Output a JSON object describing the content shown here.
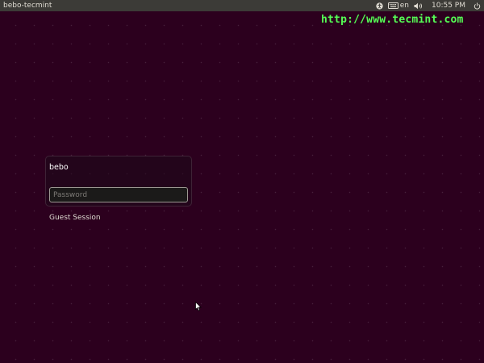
{
  "topbar": {
    "hostname": "bebo-tecmint",
    "keyboard_layout": "en",
    "clock": "10:55 PM",
    "icons": [
      "accessibility-icon",
      "keyboard-icon",
      "volume-icon",
      "power-icon"
    ]
  },
  "watermark": {
    "text": "http://www.tecmint.com",
    "color": "#55ff55"
  },
  "login": {
    "username": "bebo",
    "password_placeholder": "Password",
    "password_value": ""
  },
  "guest_session": {
    "label": "Guest Session"
  },
  "colors": {
    "background": "#2c001e",
    "panel": "#3c3b37",
    "text": "#dfdbd2"
  }
}
